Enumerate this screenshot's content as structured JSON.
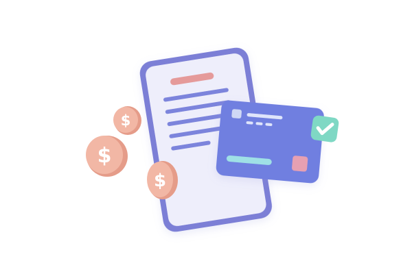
{
  "illustration": {
    "phone": {
      "frame_color": "#7b7fd6",
      "screen_color": "#eeeefb",
      "header_bar_color": "#e59a9a",
      "text_line_color": "#7b84dc",
      "text_line_count": 5
    },
    "card": {
      "color": "#6f7fe0",
      "chip_color": "#cfd8f5",
      "number_dash_color": "#dfe5fb",
      "name_bar_color": "#9fe0e6",
      "corner_square_color": "#e6a0b2",
      "badge": {
        "icon": "check-icon",
        "color": "#7fd8c4",
        "mark_color": "#ffffff"
      }
    },
    "coins": {
      "icon": "dollar-icon",
      "color": "#f2b7a5",
      "edge_color": "#e59c89",
      "symbol_color": "#ffffff",
      "count": 3
    }
  }
}
